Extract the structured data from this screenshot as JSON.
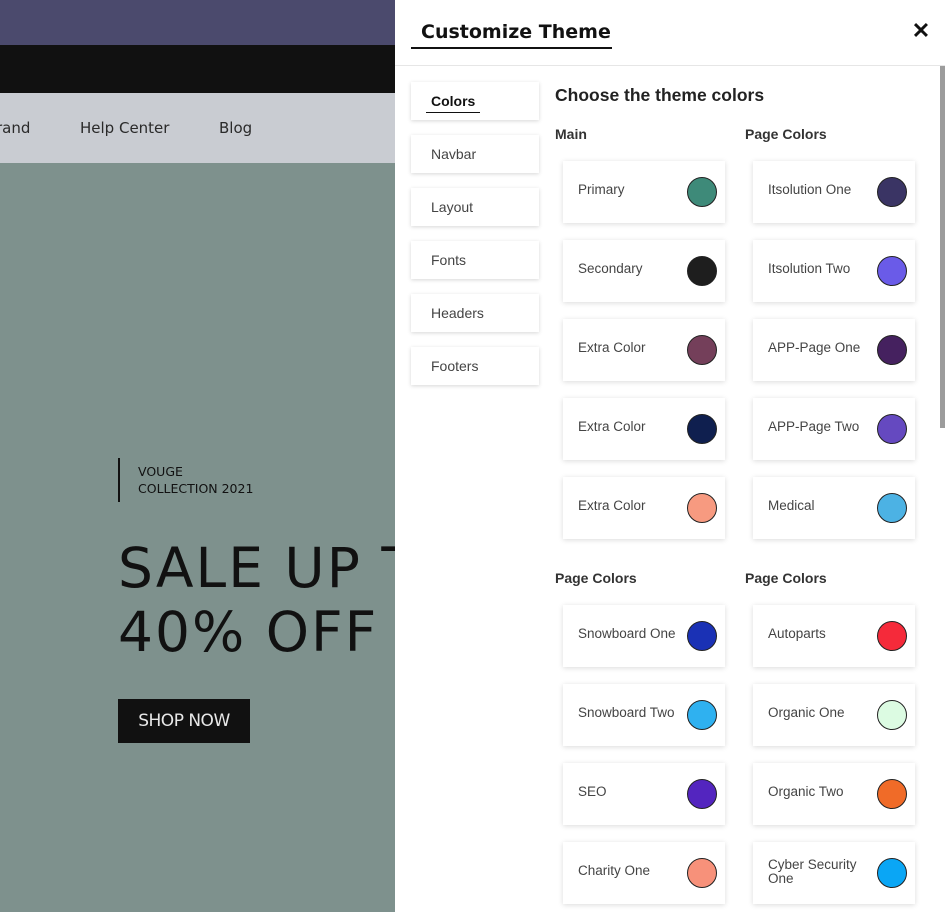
{
  "background": {
    "nav_links": [
      "rand",
      "Help Center",
      "Blog"
    ],
    "hero": {
      "tag_line1": "VOUGE",
      "tag_line2": "COLLECTION 2021",
      "title_line1": "SALE UP T",
      "title_line2": "40% OFF",
      "button": "SHOP NOW"
    }
  },
  "panel": {
    "title": "Customize Theme",
    "close": "✕",
    "tabs": [
      "Colors",
      "Navbar",
      "Layout",
      "Fonts",
      "Headers",
      "Footers"
    ],
    "active_tab": "Colors",
    "heading": "Choose the theme colors",
    "groups": [
      {
        "title": "Main",
        "colors": [
          {
            "name": "Primary",
            "hex": "#3e8a79"
          },
          {
            "name": "Secondary",
            "hex": "#1e1e1e"
          },
          {
            "name": "Extra Color",
            "hex": "#743f5a"
          },
          {
            "name": "Extra Color",
            "hex": "#0f1f4f"
          },
          {
            "name": "Extra Color",
            "hex": "#f79a80"
          }
        ]
      },
      {
        "title": "Page Colors",
        "colors": [
          {
            "name": "Itsolution One",
            "hex": "#3a3464"
          },
          {
            "name": "Itsolution Two",
            "hex": "#6a5be8"
          },
          {
            "name": "APP-Page One",
            "hex": "#45215f"
          },
          {
            "name": "APP-Page Two",
            "hex": "#6549c0"
          },
          {
            "name": "Medical",
            "hex": "#4cb2e4"
          }
        ]
      },
      {
        "title": "Page Colors",
        "colors": [
          {
            "name": "Snowboard One",
            "hex": "#1a31b5"
          },
          {
            "name": "Snowboard Two",
            "hex": "#2fb1f0"
          },
          {
            "name": "SEO",
            "hex": "#5325bf"
          },
          {
            "name": "Charity One",
            "hex": "#f7917a"
          }
        ]
      },
      {
        "title": "Page Colors",
        "colors": [
          {
            "name": "Autoparts",
            "hex": "#f52a3a"
          },
          {
            "name": "Organic One",
            "hex": "#dcfbe2"
          },
          {
            "name": "Organic Two",
            "hex": "#f06b28"
          },
          {
            "name": "Cyber Security One",
            "hex": "#0aa6f5"
          }
        ]
      }
    ]
  }
}
